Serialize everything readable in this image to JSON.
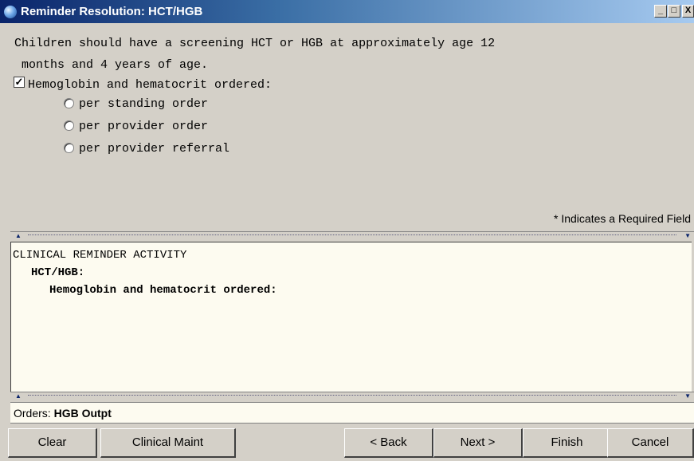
{
  "window": {
    "title": "Reminder Resolution: HCT/HGB",
    "controls": {
      "minimize": "_",
      "maximize": "□",
      "close": "X"
    }
  },
  "dialog": {
    "intro_line1": "Children should have a screening HCT or HGB at approximately age 12",
    "intro_line2": " months and 4 years of age.",
    "checkbox_label": "Hemoglobin and hematocrit ordered:",
    "checkbox_checked": true,
    "checkbox_mark": "✓",
    "options": [
      "per standing order",
      "per provider order",
      "per provider referral"
    ],
    "required_note": "* Indicates a Required Field"
  },
  "activity": {
    "header": "CLINICAL REMINDER ACTIVITY",
    "item": "HCT/HGB:",
    "sub_item": "Hemoglobin and hematocrit ordered:"
  },
  "orders": {
    "label": "Orders:",
    "value": "HGB Outpt"
  },
  "buttons": {
    "clear": "Clear",
    "clinical_maint": "Clinical Maint",
    "back": "< Back",
    "next": "Next >",
    "finish": "Finish",
    "cancel": "Cancel"
  }
}
